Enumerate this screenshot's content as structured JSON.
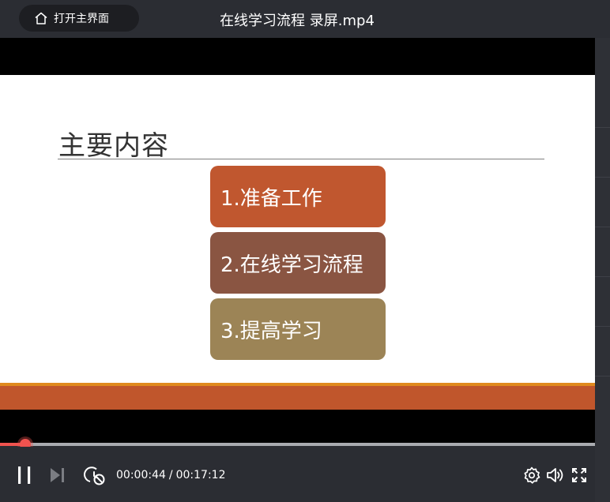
{
  "titlebar": {
    "home_label": "打开主界面",
    "title": "在线学习流程 录屏.mp4"
  },
  "slide": {
    "title": "主要内容",
    "items": [
      {
        "label": "1.准备工作",
        "color": "#c0572f"
      },
      {
        "label": "2.在线学习流程",
        "color": "#8a5542"
      },
      {
        "label": "3.提高学习",
        "color": "#9c8456"
      }
    ],
    "accent_color": "#c0562c",
    "accent_line_color": "#e08a1e"
  },
  "player": {
    "current_time": "00:00:44",
    "separator": "/",
    "total_time": "00:17:12",
    "progress": 0.0426,
    "progress_color": "#f0534f"
  }
}
